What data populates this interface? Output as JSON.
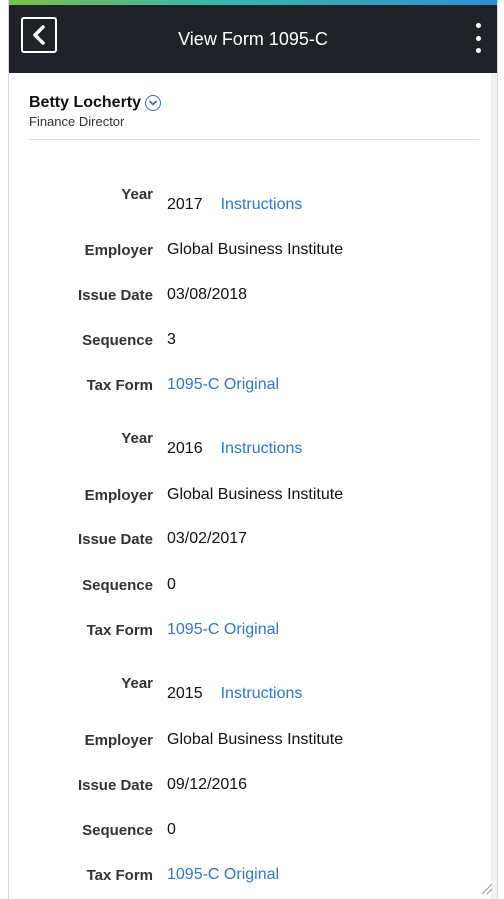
{
  "header": {
    "title": "View Form 1095-C",
    "back_icon": "chevron-left-icon",
    "menu_icon": "kebab-menu-icon"
  },
  "person": {
    "name": "Betty Locherty",
    "role": "Finance Director",
    "expand_icon": "chevron-down-circle-icon"
  },
  "labels": {
    "year": "Year",
    "employer": "Employer",
    "issue_date": "Issue Date",
    "sequence": "Sequence",
    "tax_form": "Tax Form"
  },
  "records": [
    {
      "year": "2017",
      "instructions": "Instructions",
      "employer": "Global Business Institute",
      "issue_date": "03/08/2018",
      "sequence": "3",
      "tax_form": "1095-C Original"
    },
    {
      "year": "2016",
      "instructions": "Instructions",
      "employer": "Global Business Institute",
      "issue_date": "03/02/2017",
      "sequence": "0",
      "tax_form": "1095-C Original"
    },
    {
      "year": "2015",
      "instructions": "Instructions",
      "employer": "Global Business Institute",
      "issue_date": "09/12/2016",
      "sequence": "0",
      "tax_form": "1095-C Original"
    }
  ],
  "colors": {
    "header_bg": "#1f2328",
    "link": "#2e78c7",
    "accent": "#2f6fb3"
  }
}
